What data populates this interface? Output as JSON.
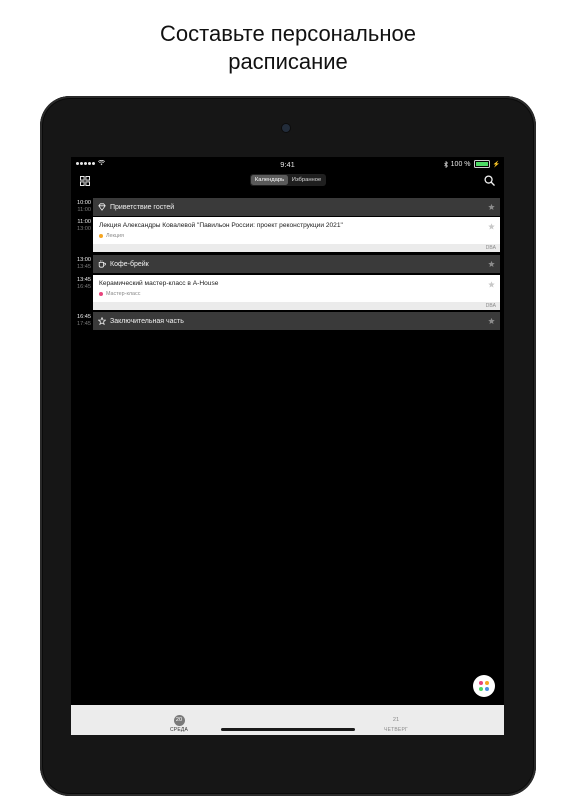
{
  "headline": {
    "line1": "Составьте персональное",
    "line2": "расписание"
  },
  "status_bar": {
    "time": "9:41",
    "battery_text": "100 %",
    "battery_level": 1.0,
    "icons": [
      "signal-dots-icon",
      "wifi-icon",
      "bluetooth-icon",
      "battery-icon",
      "charging-icon"
    ]
  },
  "nav": {
    "left_icon": "grid-icon",
    "right_icon": "search-icon",
    "segments": [
      "Календарь",
      "Избранное"
    ],
    "active_segment": "Календарь"
  },
  "schedule": [
    {
      "kind": "bar",
      "start": "10:00",
      "end": "11:00",
      "title": "Приветствие гостей",
      "icon": "diamond-icon"
    },
    {
      "kind": "card",
      "start": "11:00",
      "end": "13:00",
      "title": "Лекция Александры Ковалевой \"Павильон России: проект реконструкции 2021\"",
      "tag": "Лекция",
      "tag_color": "#f5a623",
      "footer": "DBA"
    },
    {
      "kind": "bar",
      "start": "13:00",
      "end": "13:45",
      "title": "Кофе-брейк",
      "icon": "coffee-cup-icon"
    },
    {
      "kind": "card",
      "start": "13:45",
      "end": "16:45",
      "title": "Керамический мастер-класс в A-House",
      "tag": "Мастер-класс",
      "tag_color": "#e8447d",
      "footer": "DBA"
    },
    {
      "kind": "bar",
      "start": "16:45",
      "end": "17:45",
      "title": "Заключительная часть",
      "icon": "star-outline-icon"
    }
  ],
  "fab": {
    "icon": "colored-dots-icon",
    "dot_colors": [
      "#e8447d",
      "#f5a623",
      "#4cd964",
      "#4a90e2"
    ]
  },
  "tabbar": {
    "days": [
      {
        "number": "20",
        "label": "СРЕДА",
        "active": true
      },
      {
        "number": "21",
        "label": "ЧЕТВЕРГ",
        "active": false
      }
    ]
  },
  "colors": {
    "screen_bg": "#000000",
    "bar_bg": "#3a3a3a",
    "card_bg": "#ffffff",
    "tabbar_bg": "#ececec"
  }
}
